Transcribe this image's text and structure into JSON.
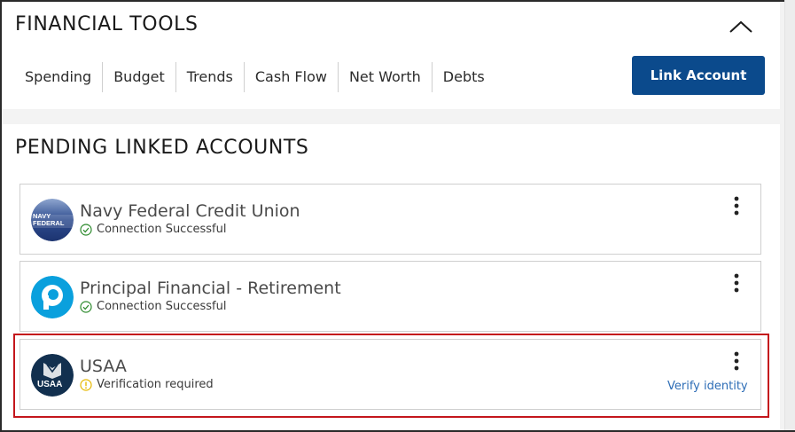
{
  "tools": {
    "title": "FINANCIAL TOOLS",
    "collapse_icon": "chevron-up-icon",
    "tabs": [
      "Spending",
      "Budget",
      "Trends",
      "Cash Flow",
      "Net Worth",
      "Debts"
    ],
    "link_account_label": "Link Account"
  },
  "pending": {
    "title": "PENDING LINKED ACCOUNTS",
    "accounts": [
      {
        "name": "Navy Federal Credit Union",
        "status": "Connection Successful",
        "status_icon": "check-circle-icon",
        "status_color": "#2e8b2e",
        "logo_text": [
          "NAVY",
          "FEDERAL"
        ]
      },
      {
        "name": "Principal Financial - Retirement",
        "status": "Connection Successful",
        "status_icon": "check-circle-icon",
        "status_color": "#2e8b2e"
      },
      {
        "name": "USAA",
        "status": "Verification required",
        "status_icon": "info-circle-icon",
        "status_color": "#e6b800",
        "action": "Verify identity",
        "logo_text": "USAA"
      }
    ]
  },
  "colors": {
    "primary": "#0b4a8c",
    "link": "#2d6db6",
    "highlight": "#c4161c"
  }
}
